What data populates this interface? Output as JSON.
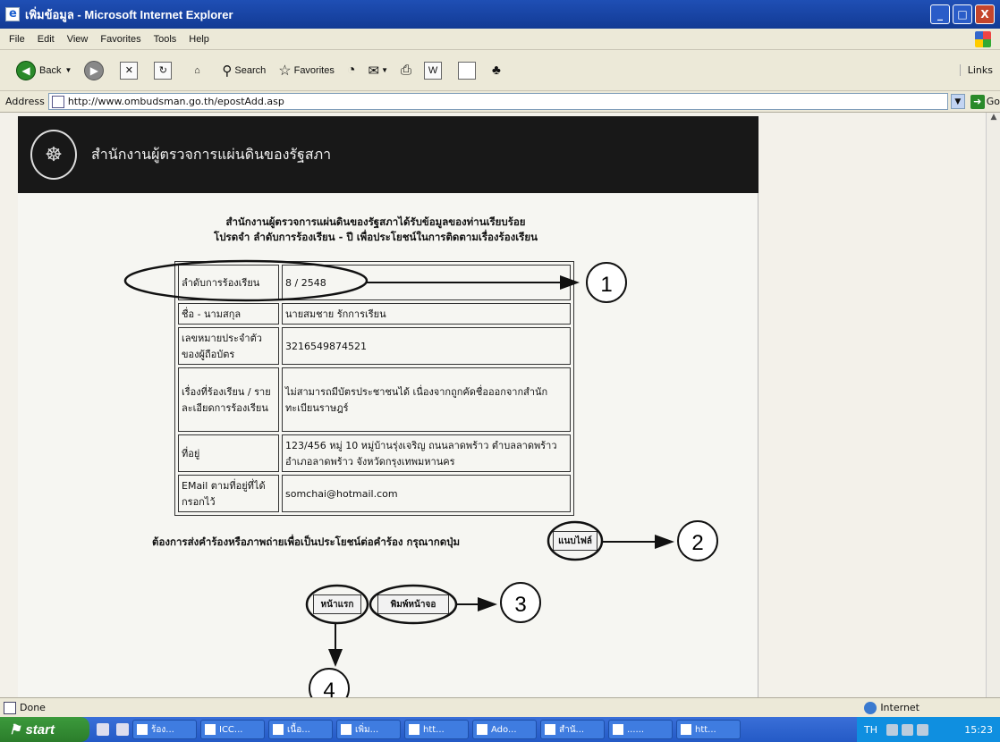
{
  "window": {
    "title": "เพิ่มข้อมูล - Microsoft Internet Explorer",
    "buttons": [
      "_",
      "□",
      "X"
    ]
  },
  "menu": [
    "File",
    "Edit",
    "View",
    "Favorites",
    "Tools",
    "Help"
  ],
  "toolbar": {
    "back": "Back",
    "search": "Search",
    "favorites": "Favorites",
    "links": "Links"
  },
  "address": {
    "label": "Address",
    "url": "http://www.ombudsman.go.th/epostAdd.asp",
    "go": "Go"
  },
  "page": {
    "org_name": "สำนักงานผู้ตรวจการแผ่นดินของรัฐสภา",
    "notice_line1": "สำนักงานผู้ตรวจการแผ่นดินของรัฐสภาได้รับข้อมูลของท่านเรียบร้อย",
    "notice_line2": "โปรดจำ ลำดับการร้องเรียน - ปี เพื่อประโยชน์ในการติดตามเรื่องร้องเรียน",
    "rows": [
      {
        "label": "ลำดับการร้องเรียน",
        "value": "8 / 2548"
      },
      {
        "label": "ชื่อ - นามสกุล",
        "value": "นายสมชาย   รักการเรียน"
      },
      {
        "label": "เลขหมายประจำตัวของผู้ถือบัตร",
        "value": "3216549874521"
      },
      {
        "label": "เรื่องที่ร้องเรียน / รายละเอียดการร้องเรียน",
        "value": "ไม่สามารถมีบัตรประชาชนได้ เนื่องจากถูกคัดชื่อออกจากสำนักทะเบียนราษฎร์"
      },
      {
        "label": "ที่อยู่",
        "value": "123/456 หมู่ 10 หมู่บ้านรุ่งเจริญ ถนนลาดพร้าว ตำบลลาดพร้าว อำเภอลาดพร้าว จังหวัดกรุงเทพมหานคร"
      },
      {
        "label": "EMail ตามที่อยู่ที่ได้กรอกไว้",
        "value": "somchai@hotmail.com"
      }
    ],
    "attach_prompt": "ต้องการส่งคำร้องหรือภาพถ่ายเพื่อเป็นประโยชน์ต่อคำร้อง กรุณากดปุ่ม",
    "attach_button": "แนบไฟล์",
    "home_button": "หน้าแรก",
    "print_button": "พิมพ์หน้าจอ"
  },
  "annotations": [
    "1",
    "2",
    "3",
    "4"
  ],
  "status": {
    "text": "Done",
    "zone": "Internet"
  },
  "taskbar": {
    "start": "start",
    "items": [
      "ร้อง...",
      "ICC...",
      "เนื้อ...",
      "เพิ่ม...",
      "htt...",
      "Ado...",
      "สำนั...",
      "......",
      "htt..."
    ],
    "lang": "TH",
    "clock": "15:23"
  },
  "colors": {
    "banner": "#181818",
    "titlebar": "#1f4fb5",
    "taskbar": "#245ac6"
  }
}
